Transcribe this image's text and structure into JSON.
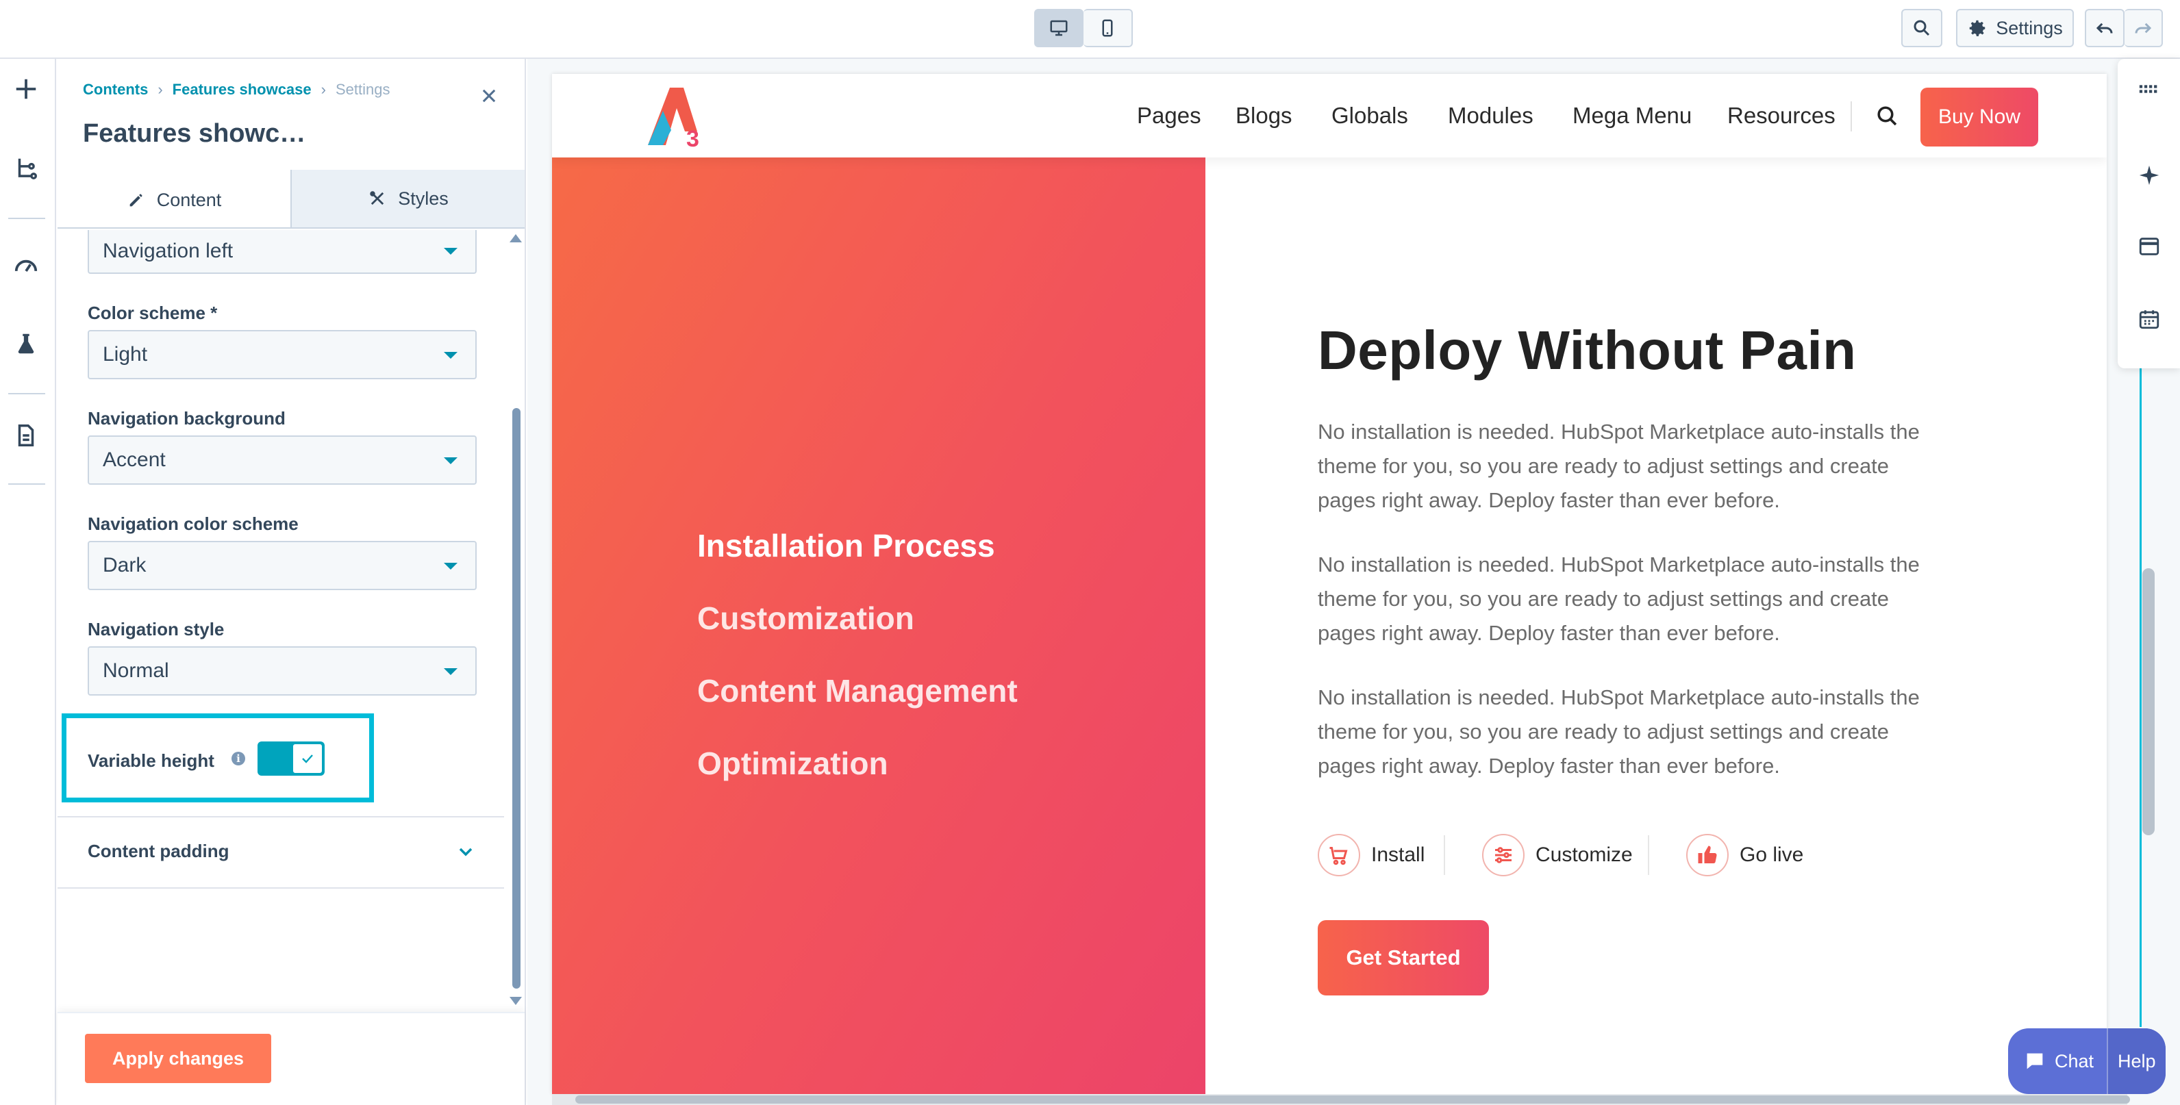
{
  "toolbar": {
    "settings_label": "Settings",
    "device_desktop_icon": "desktop-icon",
    "device_mobile_icon": "mobile-icon"
  },
  "panel": {
    "breadcrumb": [
      "Contents",
      "Features showcase",
      "Settings"
    ],
    "title": "Features showc…",
    "tabs": [
      {
        "label": "Content",
        "icon": "pencil-icon",
        "active": true
      },
      {
        "label": "Styles",
        "icon": "styles-icon",
        "active": false
      }
    ],
    "fields": {
      "layout_value": "Navigation left",
      "color_scheme_label": "Color scheme *",
      "color_scheme_value": "Light",
      "nav_background_label": "Navigation background",
      "nav_background_value": "Accent",
      "nav_color_scheme_label": "Navigation color scheme",
      "nav_color_scheme_value": "Dark",
      "nav_style_label": "Navigation style",
      "nav_style_value": "Normal",
      "variable_height_label": "Variable height",
      "variable_height_on": true,
      "content_padding_label": "Content padding"
    },
    "apply_label": "Apply changes"
  },
  "site": {
    "nav": [
      "Pages",
      "Blogs",
      "Globals",
      "Modules",
      "Mega Menu",
      "Resources"
    ],
    "buy_label": "Buy Now",
    "features": [
      "Installation Process",
      "Customization",
      "Content Management",
      "Optimization"
    ],
    "headline": "Deploy Without Pain",
    "paragraphs": [
      "No installation is needed. HubSpot Marketplace auto-installs the theme for you, so you are ready to adjust settings and create pages right away. Deploy faster than ever before.",
      "No installation is needed. HubSpot Marketplace auto-installs the theme for you, so you are ready to adjust settings and create pages right away. Deploy faster than ever before.",
      "No installation is needed. HubSpot Marketplace auto-installs the theme for you, so you are ready to adjust settings and create pages right away. Deploy faster than ever before."
    ],
    "actions": [
      {
        "label": "Install",
        "icon": "cart-icon"
      },
      {
        "label": "Customize",
        "icon": "sliders-icon"
      },
      {
        "label": "Go live",
        "icon": "thumbs-up-icon"
      }
    ],
    "cta_label": "Get Started"
  },
  "chat": {
    "chat_label": "Chat",
    "help_label": "Help"
  },
  "colors": {
    "accent": "#ff7a59",
    "teal": "#00a4bd",
    "highlight": "#00bcd9",
    "gradient_start": "#f66a47",
    "gradient_end": "#ec4469"
  }
}
